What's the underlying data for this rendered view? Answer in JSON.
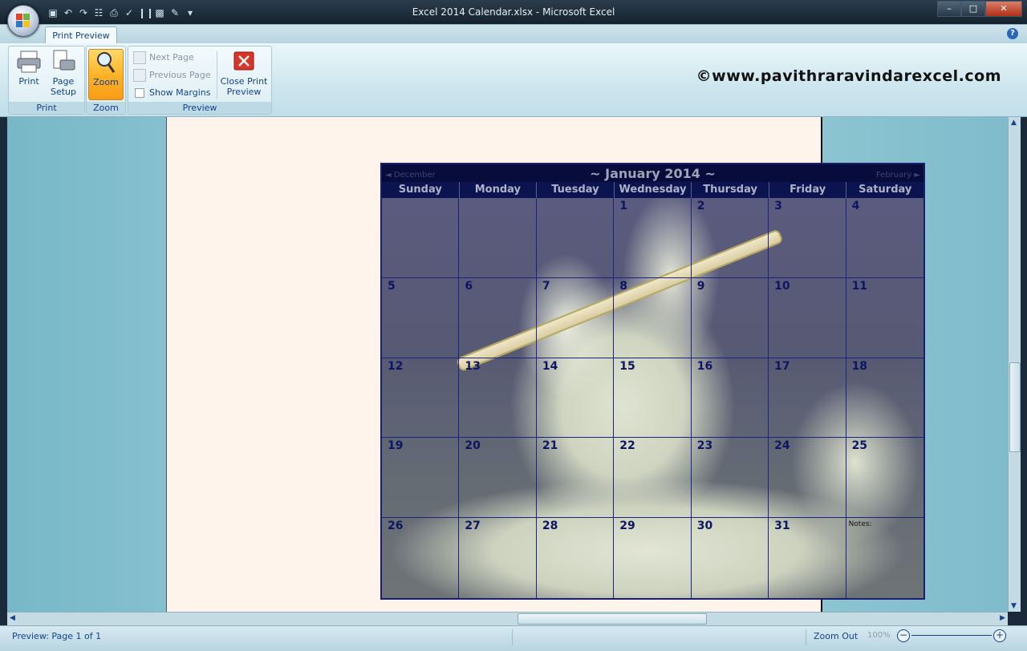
{
  "window": {
    "title": "Excel 2014 Calendar.xlsx  -  Microsoft Excel"
  },
  "ribbon": {
    "active_tab": "Print Preview",
    "groups": {
      "print": {
        "label": "Print",
        "print_button": "Print",
        "page_setup_button": [
          "Page",
          "Setup"
        ]
      },
      "zoom": {
        "label": "Zoom",
        "zoom_button": "Zoom"
      },
      "preview": {
        "label": "Preview",
        "next_page": "Next Page",
        "previous_page": "Previous Page",
        "show_margins": "Show Margins",
        "show_margins_checked": false,
        "close_button": [
          "Close Print",
          "Preview"
        ]
      }
    },
    "watermark": "©www.pavithraravindarexcel.com"
  },
  "calendar": {
    "title": "~ January 2014 ~",
    "prev_month": "◄ December",
    "next_month": "February ►",
    "weekdays": [
      "Sunday",
      "Monday",
      "Tuesday",
      "Wednesday",
      "Thursday",
      "Friday",
      "Saturday"
    ],
    "weeks": [
      [
        "",
        "",
        "",
        "1",
        "2",
        "3",
        "4"
      ],
      [
        "5",
        "6",
        "7",
        "8",
        "9",
        "10",
        "11"
      ],
      [
        "12",
        "13",
        "14",
        "15",
        "16",
        "17",
        "18"
      ],
      [
        "19",
        "20",
        "21",
        "22",
        "23",
        "24",
        "25"
      ],
      [
        "26",
        "27",
        "28",
        "29",
        "30",
        "31",
        ""
      ]
    ],
    "notes_label": "Notes:"
  },
  "status": {
    "text": "Preview: Page 1 of 1",
    "zoom_out": "Zoom Out",
    "zoom_percent": "100%"
  },
  "colors": {
    "accent": "#15428b",
    "ribbon_bg": "#cde6ee",
    "calendar_header": "#070c3d"
  }
}
